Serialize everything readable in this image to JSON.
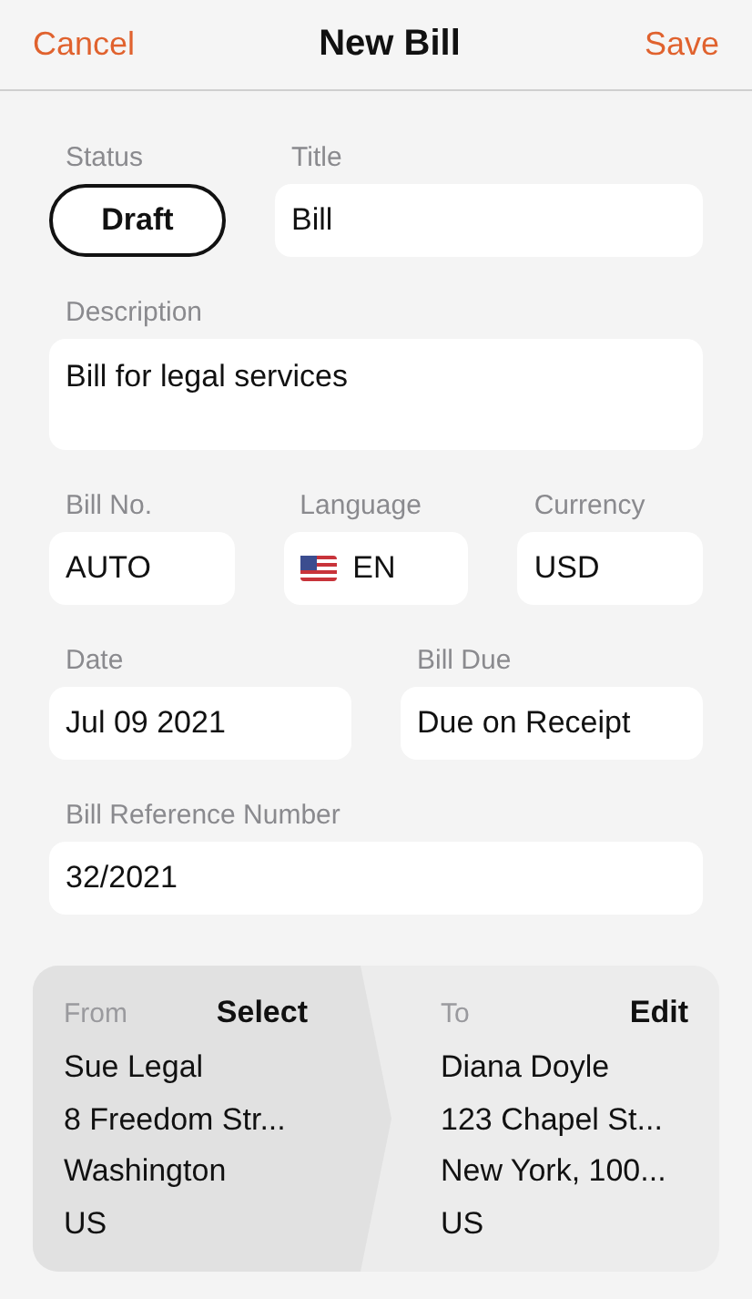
{
  "nav": {
    "cancel": "Cancel",
    "title": "New Bill",
    "save": "Save"
  },
  "rows": [
    [
      {
        "kind": "status",
        "label": "Status",
        "value": "Draft"
      },
      {
        "kind": "text",
        "label": "Title",
        "value": "Bill"
      }
    ],
    [
      {
        "kind": "multiline",
        "label": "Description",
        "value": "Bill for legal services"
      }
    ],
    [
      {
        "kind": "text",
        "label": "Bill No.",
        "value": "AUTO"
      },
      {
        "kind": "language",
        "label": "Language",
        "value": "EN"
      },
      {
        "kind": "text",
        "label": "Currency",
        "value": "USD"
      }
    ],
    [
      {
        "kind": "text",
        "label": "Date",
        "value": "Jul 09 2021"
      },
      {
        "kind": "text",
        "label": "Bill Due",
        "value": "Due on Receipt"
      }
    ],
    [
      {
        "kind": "text",
        "label": "Bill Reference Number",
        "value": "32/2021"
      }
    ]
  ],
  "parties": {
    "from": {
      "label": "From",
      "action": "Select",
      "lines": [
        "Sue Legal",
        "8 Freedom Str...",
        "Washington",
        "US"
      ]
    },
    "to": {
      "label": "To",
      "action": "Edit",
      "lines": [
        "Diana Doyle",
        "123 Chapel St...",
        "New York, 100...",
        "US"
      ]
    }
  }
}
